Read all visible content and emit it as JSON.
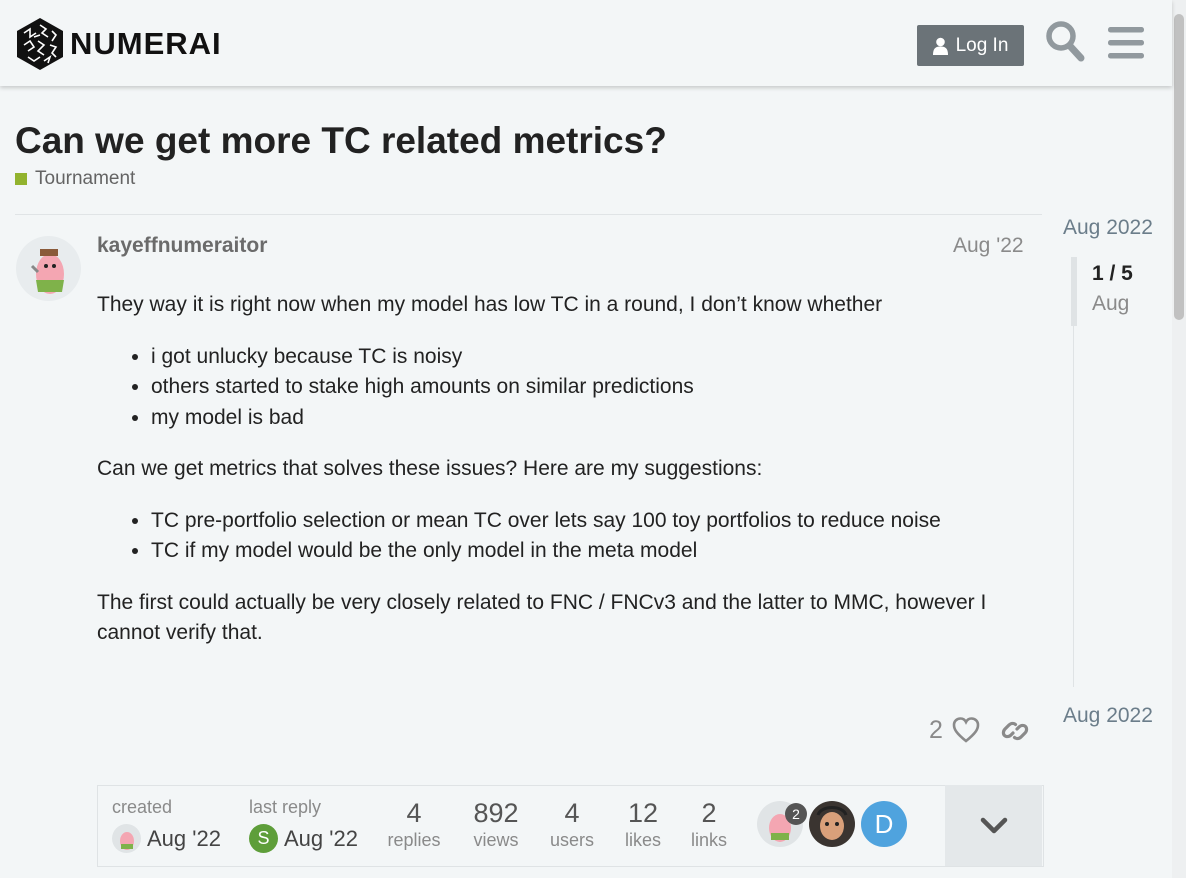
{
  "header": {
    "logo_text": "NUMERAI",
    "login_label": "Log In",
    "search_icon": "search-icon",
    "menu_icon": "hamburger-menu-icon"
  },
  "topic": {
    "title": "Can we get more TC related metrics?",
    "category": "Tournament",
    "category_color": "#92b32e"
  },
  "post": {
    "username": "kayeffnumeraitor",
    "date": "Aug '22",
    "paragraphs": [
      "They way it is right now when my model has low TC in a round, I don’t know whether",
      "Can we get metrics that solves these issues? Here are my suggestions:",
      "The first could actually be very closely related to FNC / FNCv3 and the latter to MMC, however I cannot verify that."
    ],
    "list1": [
      "i got unlucky because TC is noisy",
      "others started to stake high amounts on similar predictions",
      "my model is bad"
    ],
    "list2": [
      "TC pre-portfolio selection or mean TC over lets say 100 toy portfolios to reduce noise",
      "TC if my model would be the only model in the meta model"
    ],
    "like_count": "2"
  },
  "topic_map": {
    "created_label": "created",
    "created_date": "Aug '22",
    "last_reply_label": "last reply",
    "last_reply_date": "Aug '22",
    "last_reply_avatar_letter": "S",
    "stats": [
      {
        "num": "4",
        "label": "replies"
      },
      {
        "num": "892",
        "label": "views"
      },
      {
        "num": "4",
        "label": "users"
      },
      {
        "num": "12",
        "label": "likes"
      },
      {
        "num": "2",
        "label": "links"
      }
    ],
    "participant_badge": "2",
    "participant_letter": "D"
  },
  "timeline": {
    "top_date": "Aug 2022",
    "counter": "1 / 5",
    "sub": "Aug",
    "bottom_date": "Aug 2022"
  }
}
